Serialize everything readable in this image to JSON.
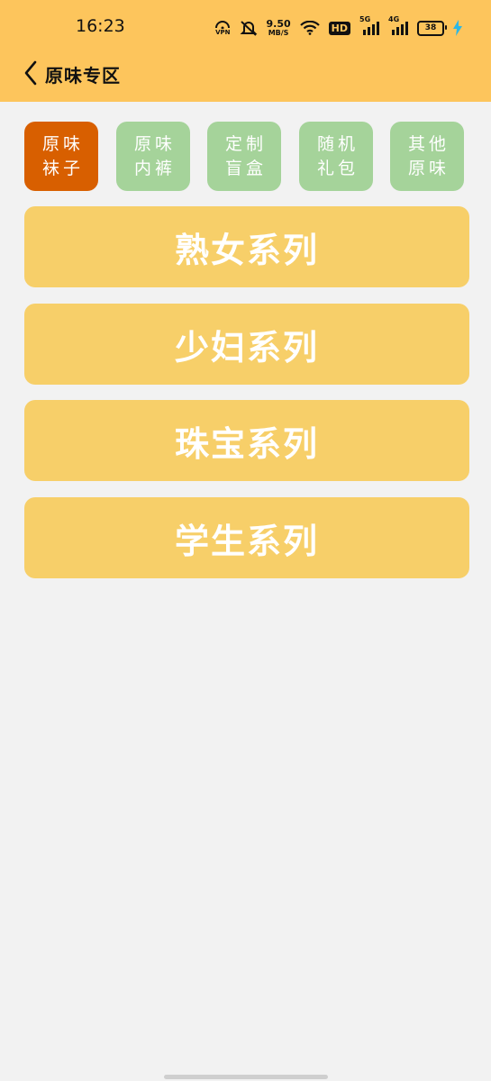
{
  "status_bar": {
    "time": "16:23",
    "vpn_label": "VPN",
    "net_speed_value": "9.50",
    "net_speed_unit": "MB/S",
    "hd_label": "HD",
    "sim1_label": "5G",
    "sim2_label": "4G",
    "battery_level": "38"
  },
  "header": {
    "title": "原味专区",
    "background_color": "#fdc55c"
  },
  "tabs": [
    {
      "line1": "原味",
      "line2": "袜子",
      "active": true
    },
    {
      "line1": "原味",
      "line2": "内裤",
      "active": false
    },
    {
      "line1": "定制",
      "line2": "盲盒",
      "active": false
    },
    {
      "line1": "随机",
      "line2": "礼包",
      "active": false
    },
    {
      "line1": "其他",
      "line2": "原味",
      "active": false
    }
  ],
  "series": [
    {
      "label": "熟女系列"
    },
    {
      "label": "少妇系列"
    },
    {
      "label": "珠宝系列"
    },
    {
      "label": "学生系列"
    }
  ],
  "colors": {
    "tab_active": "#d85f00",
    "tab_inactive": "#a5d39a",
    "series_button": "#f7cf69",
    "page_background": "#f2f2f2"
  }
}
